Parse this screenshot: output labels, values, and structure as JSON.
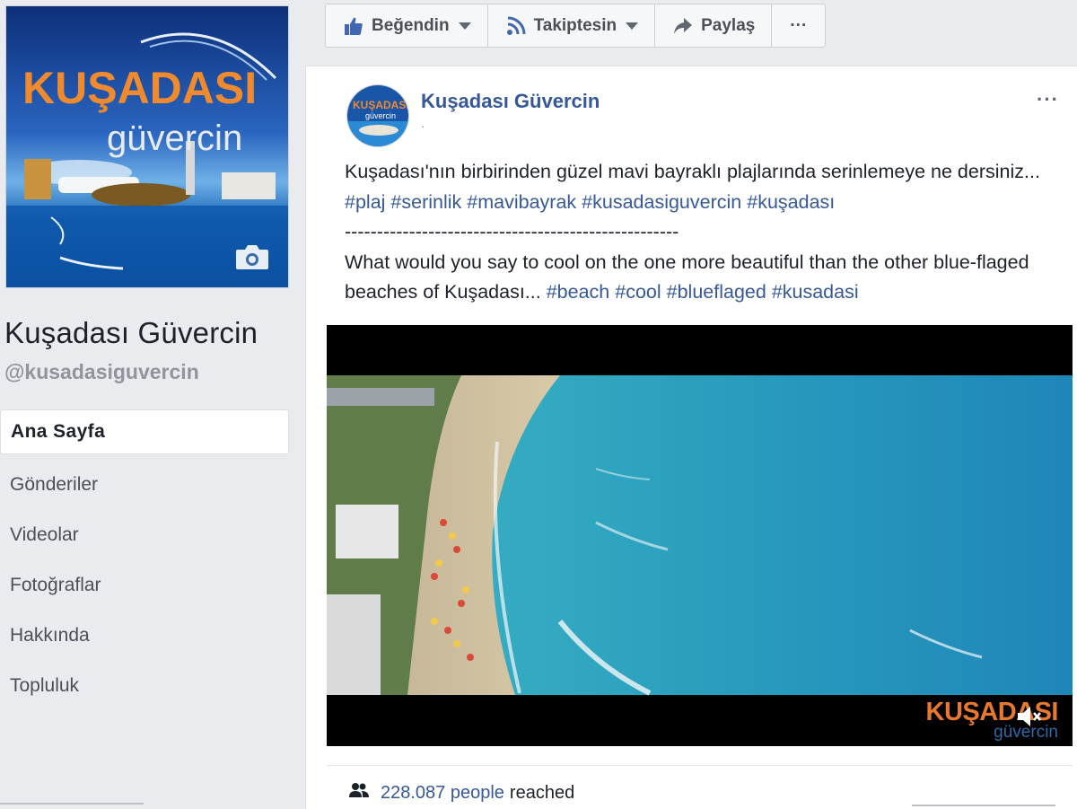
{
  "page": {
    "name": "Kuşadası Güvercin",
    "handle": "@kusadasiguvercin"
  },
  "cover": {
    "title_line1": "KUŞADASI",
    "title_line2": "güvercin",
    "camera_icon": "camera-icon"
  },
  "nav": {
    "items": [
      {
        "label": "Ana Sayfa",
        "active": true
      },
      {
        "label": "Gönderiler",
        "active": false
      },
      {
        "label": "Videolar",
        "active": false
      },
      {
        "label": "Fotoğraflar",
        "active": false
      },
      {
        "label": "Hakkında",
        "active": false
      },
      {
        "label": "Topluluk",
        "active": false
      }
    ]
  },
  "actionbar": {
    "like_label": "Beğendin",
    "follow_label": "Takiptesin",
    "share_label": "Paylaş",
    "more_label": "···"
  },
  "post": {
    "author": "Kuşadası Güvercin",
    "meta": "·",
    "more_label": "···",
    "text_tr": "Kuşadası'nın birbirinden güzel mavi bayraklı plajlarında serinlemeye ne dersiniz...",
    "tags_tr": [
      "#plaj",
      "#serinlik",
      "#mavibayrak",
      "#kusadasiguvercin",
      "#kuşadası"
    ],
    "separator": "----------------------------------------------------",
    "text_en": "What would you say to cool on the one more beautiful than the other blue-flaged beaches of Kuşadası...",
    "tags_en": [
      "#beach",
      "#cool",
      "#blueflaged",
      "#kusadasi"
    ]
  },
  "video": {
    "logo_line1": "KUŞADASI",
    "logo_line2": "güvercin"
  },
  "reach": {
    "count": "228.087 people",
    "suffix": "reached"
  },
  "colors": {
    "link": "#365899",
    "background": "#e9ebee",
    "brand_orange": "#e8782a",
    "brand_blue": "#1a4f9a"
  }
}
